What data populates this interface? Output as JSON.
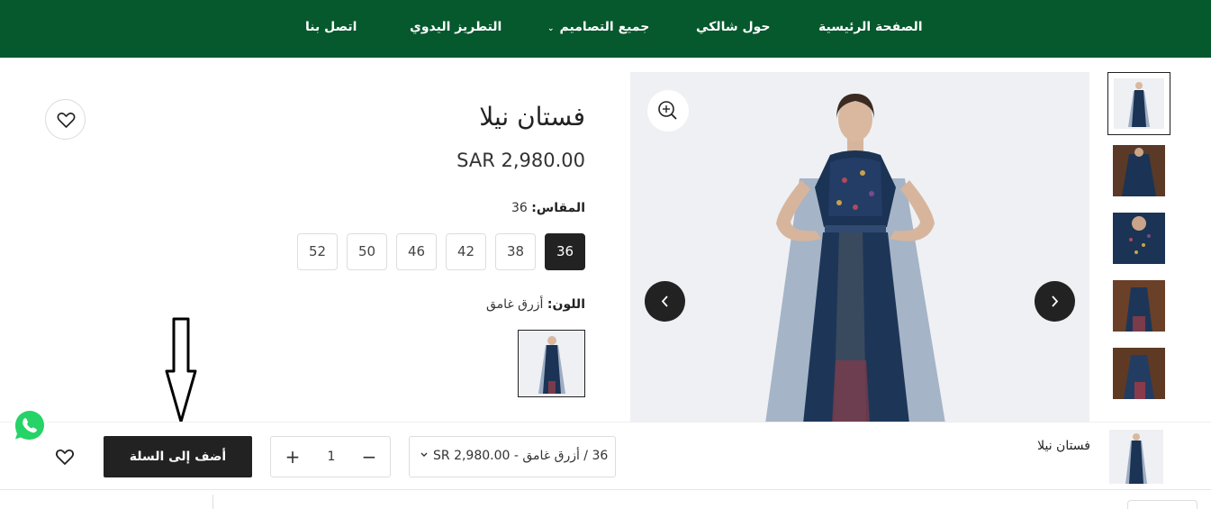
{
  "nav": {
    "items": [
      {
        "label": "الصفحة الرئيسية"
      },
      {
        "label": "حول شالكي"
      },
      {
        "label": "جميع التصاميم",
        "caret": "⌄"
      },
      {
        "label": "التطريز اليدوي"
      },
      {
        "label": "اتصل بنا"
      }
    ]
  },
  "gallery": {
    "zoom_icon": "zoom-in-icon",
    "prev_icon": "chevron-left-icon",
    "next_icon": "chevron-right-icon",
    "thumbnail_count": 6,
    "active_thumbnail": 1
  },
  "product": {
    "title": "فستان نيلا",
    "price": "SAR 2,980.00",
    "size_label": "المقاس:",
    "size_value": "36",
    "sizes": [
      "36",
      "38",
      "42",
      "46",
      "50",
      "52"
    ],
    "selected_size": "36",
    "color_label": "اللون:",
    "color_value": "أزرق غامق"
  },
  "sticky": {
    "title": "فستان نيلا",
    "variant": "36 / أزرق غامق - SR 2,980.00",
    "quantity": "1",
    "minus": "−",
    "plus": "+",
    "add_to_cart": "أضف إلى السلة"
  },
  "colors": {
    "nav_bg": "#06582d",
    "primary_button": "#222222",
    "dress": "#1b3354"
  }
}
